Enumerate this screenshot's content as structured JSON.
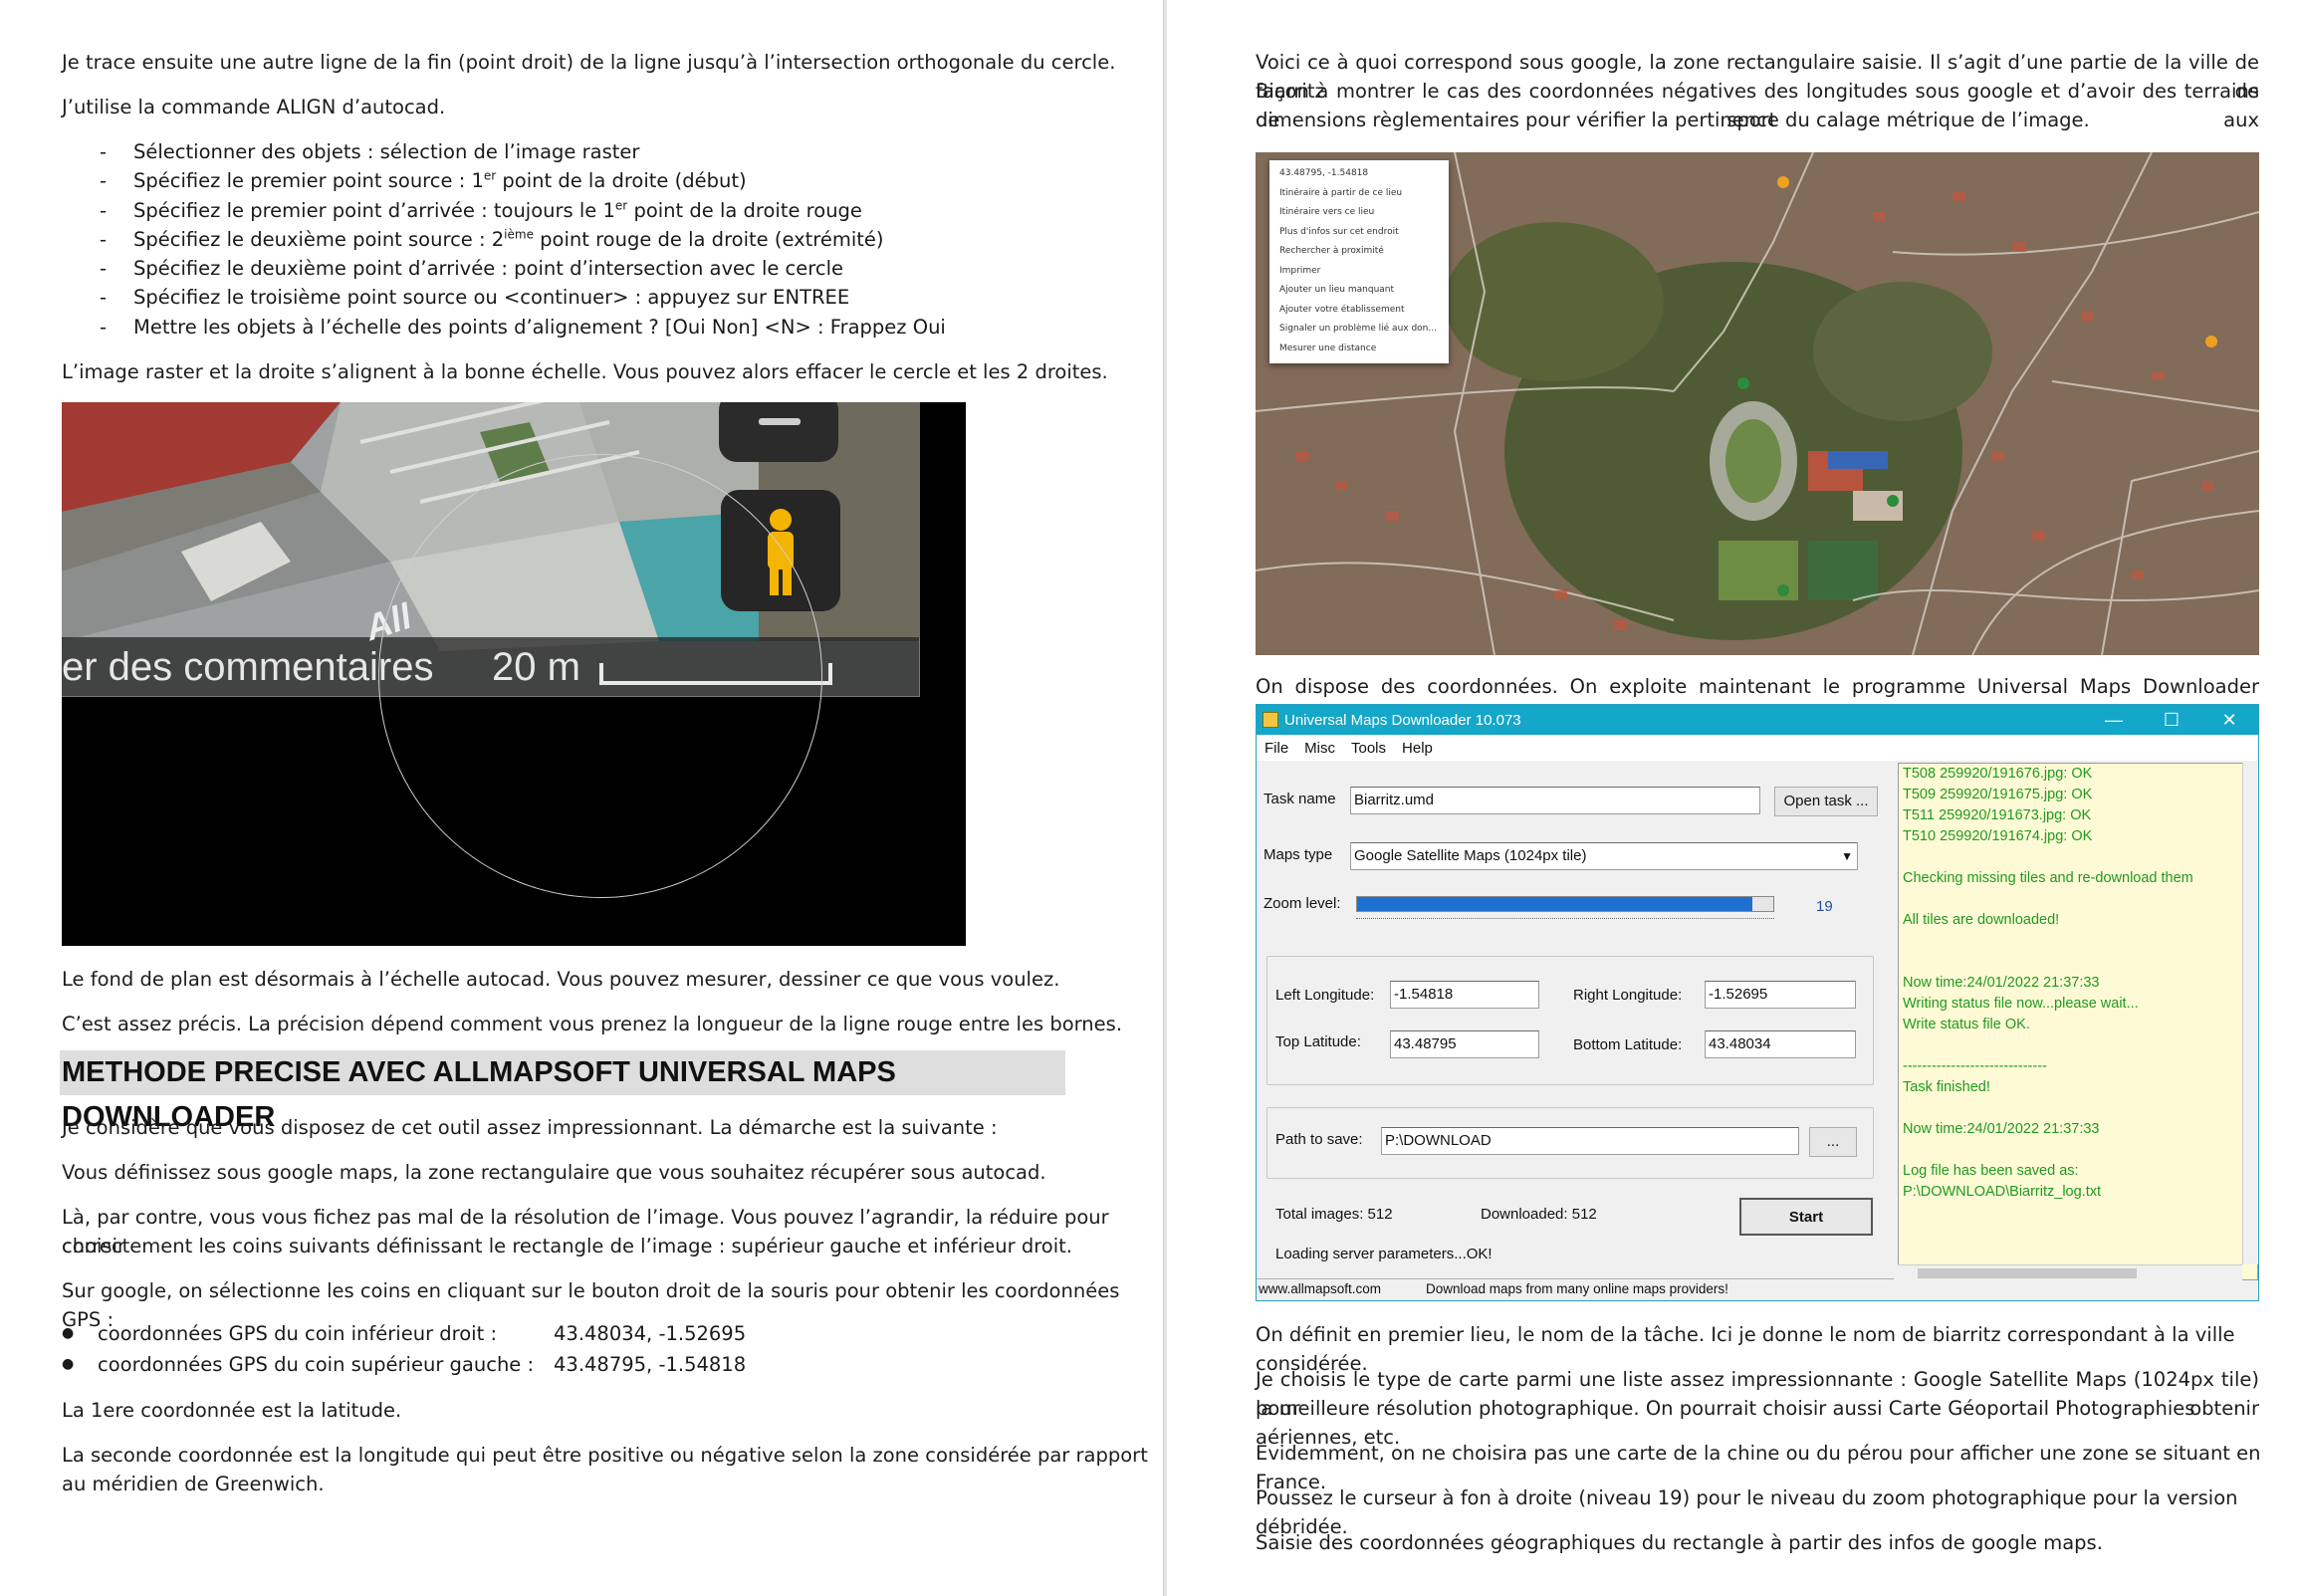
{
  "left": {
    "p1": "Je trace ensuite une autre ligne de la fin (point droit) de la ligne jusqu’à l’intersection orthogonale du cercle.",
    "p2": "J’utilise la commande ALIGN d’autocad.",
    "steps": [
      {
        "mark": "-",
        "text": "Sélectionner des objets : sélection de l’image raster"
      },
      {
        "mark": "-",
        "pre": "Spécifiez le premier point source : 1",
        "sup": "er",
        "post": " point de la droite (début)"
      },
      {
        "mark": "-",
        "pre": "Spécifiez le premier point d’arrivée : toujours le 1",
        "sup": "er",
        "post": " point de la droite rouge"
      },
      {
        "mark": "-",
        "pre": "Spécifiez le deuxième point source : 2",
        "sup": "ième",
        "post": " point rouge de la droite (extrémité)"
      },
      {
        "mark": "-",
        "text": "Spécifiez le deuxième point d’arrivée : point d’intersection avec le cercle"
      },
      {
        "mark": "-",
        "text": "Spécifiez le troisième point source ou <continuer> : appuyez sur ENTREE"
      },
      {
        "mark": "-",
        "text": "Mettre les objets à l’échelle des points d’alignement ? [Oui Non] <N> : Frappez Oui"
      }
    ],
    "p3": "L’image raster et la droite s’alignent à la bonne échelle. Vous pouvez alors effacer le cercle et les 2 droites.",
    "figure": {
      "comments": "er des commentaires",
      "scale": "20 m",
      "overlay": "All"
    },
    "p4": "Le fond de plan est désormais à l’échelle autocad. Vous pouvez mesurer, dessiner ce que vous voulez.",
    "p5": "C’est assez précis. La précision dépend comment vous prenez la longueur de la ligne rouge entre les bornes.",
    "heading": "METHODE PRECISE AVEC ALLMAPSOFT UNIVERSAL MAPS DOWNLOADER",
    "p6": "Je considère que vous disposez de cet outil assez impressionnant. La démarche est la suivante :",
    "p7": "Vous définissez sous google maps, la zone rectangulaire que vous souhaitez récupérer sous autocad.",
    "p8a": "Là, par contre, vous vous fichez pas mal de la résolution de l’image. Vous pouvez l’agrandir, la réduire pour choisir",
    "p8b": "correctement les coins suivants définissant le rectangle de l’image : supérieur gauche et inférieur droit.",
    "p9": "Sur google, on sélectionne les coins en cliquant sur le bouton droit de la souris pour obtenir les coordonnées GPS :",
    "coords": [
      {
        "label": "coordonnées GPS du coin inférieur droit :",
        "value": "43.48034, -1.52695"
      },
      {
        "label": "coordonnées GPS du coin supérieur gauche :",
        "value": "43.48795, -1.54818"
      }
    ],
    "p10": "La 1ere coordonnée est la latitude.",
    "p11a": "La seconde coordonnée est la longitude qui peut être positive ou négative selon la zone considérée par rapport",
    "p11b": "au méridien de Greenwich."
  },
  "right": {
    "intro1": "Voici ce à quoi correspond sous google, la zone rectangulaire saisie.  Il s’agit d’une partie de la ville de Biarritz de",
    "intro2": "façon à montrer le cas des coordonnées négatives des longitudes sous google et d’avoir des terrains de sport aux",
    "intro3": "dimensions règlementaires pour vérifier la pertinence du calage métrique de l’image.",
    "context_menu": [
      "43.48795, -1.54818",
      "Itinéraire à partir de ce lieu",
      "Itinéraire vers ce lieu",
      "Plus d'infos sur cet endroit",
      "Rechercher à proximité",
      "Imprimer",
      "Ajouter un lieu manquant",
      "Ajouter votre établissement",
      "Signaler un problème lié aux don...",
      "Mesurer une distance"
    ],
    "lead": "On dispose des coordonnées. On exploite maintenant le programme Universal Maps Downloader v10.073",
    "umd": {
      "title": "Universal Maps Downloader 10.073",
      "win_min": "—",
      "win_max": "☐",
      "win_close": "✕",
      "menu": [
        "File",
        "Misc",
        "Tools",
        "Help"
      ],
      "task_label": "Task name",
      "task_value": "Biarritz.umd",
      "open_task": "Open task ...",
      "maps_label": "Maps type",
      "maps_value": "Google Satellite Maps (1024px tile)",
      "zoom_label": "Zoom level:",
      "zoom_value": "19",
      "zoom_fraction": 0.95,
      "left_lon_label": "Left Longitude:",
      "left_lon": "-1.54818",
      "right_lon_label": "Right Longitude:",
      "right_lon": "-1.52695",
      "top_lat_label": "Top Latitude:",
      "top_lat": "43.48795",
      "bottom_lat_label": "Bottom Latitude:",
      "bottom_lat": "43.48034",
      "path_label": "Path to save:",
      "path_value": "P:\\DOWNLOAD",
      "browse": "...",
      "total": "Total images: 512",
      "downloaded": "Downloaded: 512",
      "start": "Start",
      "loading": "Loading server parameters...OK!",
      "status_site": "www.allmapsoft.com",
      "status_msg": "Download maps from many online maps providers!",
      "log": [
        "T508 259920/191676.jpg: OK",
        "T509 259920/191675.jpg: OK",
        "T511 259920/191673.jpg: OK",
        "T510 259920/191674.jpg: OK",
        "",
        "Checking missing tiles and re-download them",
        "",
        "All tiles are downloaded!",
        "",
        "",
        "Now time:24/01/2022 21:37:33",
        "Writing status file now...please wait...",
        "Write status file OK.",
        "",
        "------------------------------",
        "Task finished!",
        "",
        "Now time:24/01/2022 21:37:33",
        "",
        "Log file has been saved as:",
        "P:\\DOWNLOAD\\Biarritz_log.txt"
      ]
    },
    "p1": "On définit en premier lieu, le nom de la tâche. Ici je donne le nom de biarritz correspondant à la ville considérée.",
    "p2a": "Je choisis le type de carte parmi une liste assez impressionnante : Google Satellite Maps (1024px tile) pour obtenir",
    "p2b": "la meilleure résolution photographique. On pourrait choisir aussi Carte Géoportail Photographies aériennes, etc.",
    "p3": "Evidemment, on ne choisira pas une carte de la chine ou du pérou pour afficher une zone se situant en France.",
    "p4": "Poussez le curseur à fon à droite (niveau 19) pour le niveau du zoom photographique pour la version débridée.",
    "p5": "Saisie des coordonnées géographiques du rectangle à partir des infos de google maps."
  }
}
